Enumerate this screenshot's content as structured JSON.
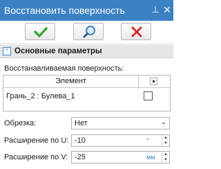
{
  "window": {
    "title": "Восстановить поверхность",
    "pin_glyph": "⊥",
    "close_glyph": "✕"
  },
  "toolbar": {
    "ok_icon": "checkmark-icon",
    "preview_icon": "magnifier-icon",
    "cancel_icon": "cross-icon",
    "colors": {
      "ok": "#3aa83a",
      "cancel": "#d92b2b",
      "preview": "#3b82c4"
    }
  },
  "section": {
    "toggle_glyph": "⌃",
    "title": "Основные параметры"
  },
  "surface": {
    "caption": "Восстанавливаемая поверхность:",
    "columns": {
      "element": "Элемент",
      "icon": "select-icon"
    },
    "rows": [
      {
        "element": "Грань_2 : Булева_1",
        "checked": false
      }
    ]
  },
  "trim": {
    "label": "Обрезка:",
    "value": "Нет",
    "arrow": "⌄"
  },
  "extend_u": {
    "label": "Расширение по U:",
    "value": "-10",
    "unit": "°",
    "spin_up": "▲",
    "spin_down": "▼"
  },
  "extend_v": {
    "label": "Расширение по V:",
    "value": "-25",
    "unit": "мм",
    "spin_up": "▲",
    "spin_down": "▼"
  },
  "colors": {
    "titlebar": "#3b82c4",
    "accent": "#3b82c4"
  }
}
